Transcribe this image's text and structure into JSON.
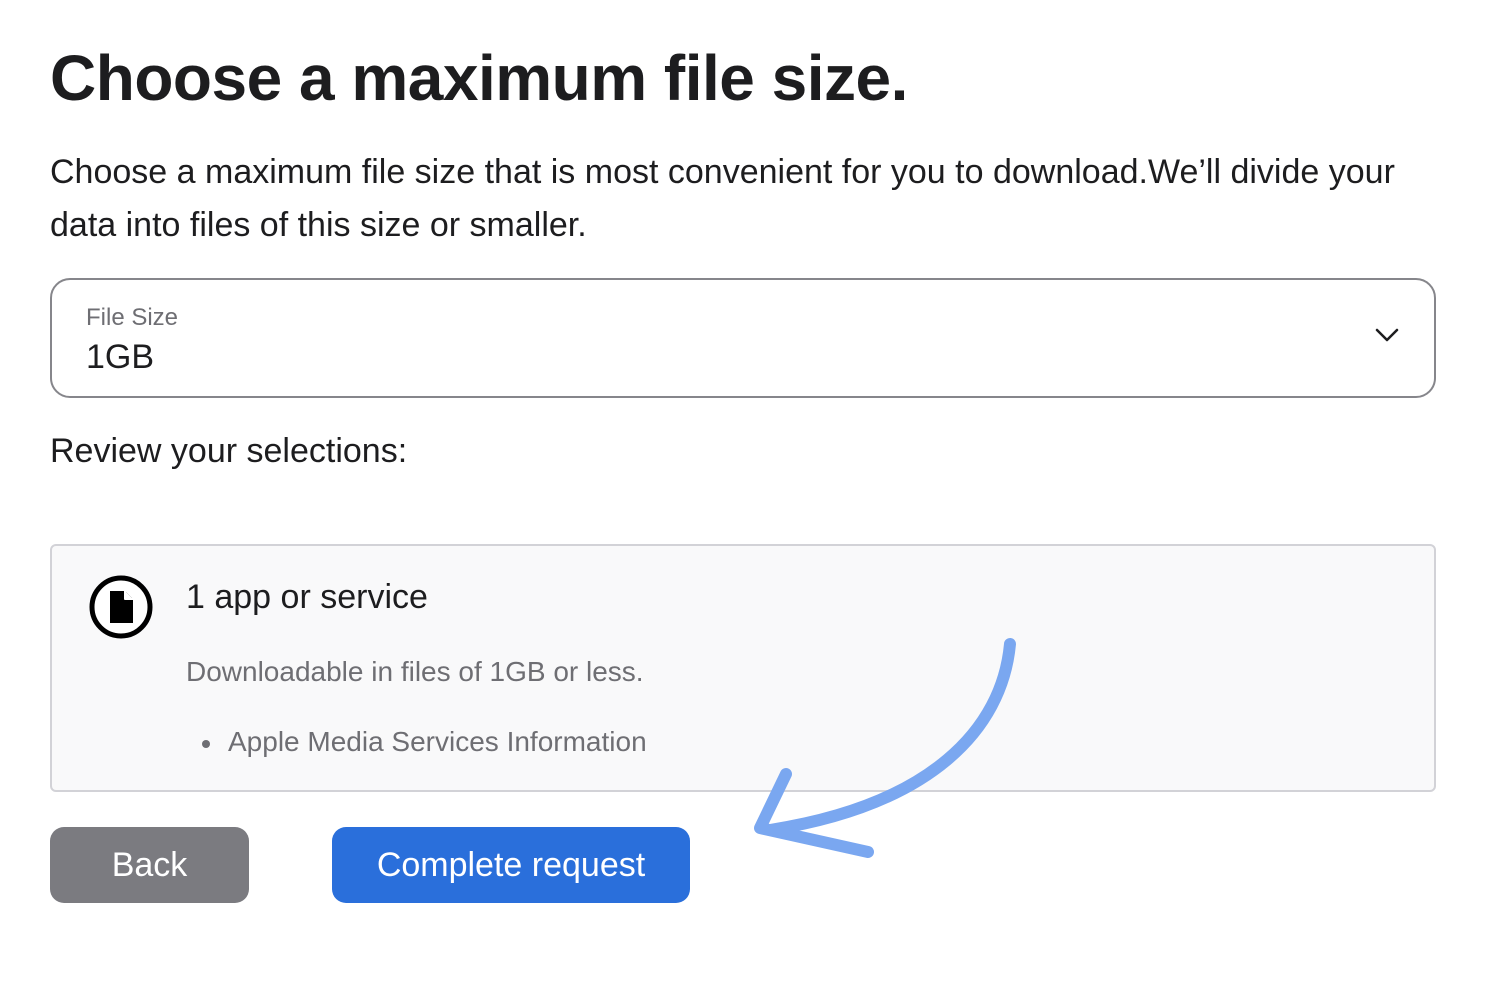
{
  "page": {
    "title": "Choose a maximum file size.",
    "description": "Choose a maximum file size that is most convenient for you to download.We’ll divide your data into files of this size or smaller."
  },
  "file_size_select": {
    "label": "File Size",
    "selected_value": "1GB",
    "icon": "chevron-down-icon"
  },
  "review": {
    "heading": "Review your selections:",
    "summary": {
      "icon": "document-icon",
      "title": "1 app or service",
      "subtitle": "Downloadable in files of 1GB or less.",
      "items": [
        "Apple Media Services Information"
      ]
    }
  },
  "actions": {
    "back_label": "Back",
    "complete_label": "Complete request"
  },
  "annotation": {
    "icon": "hand-drawn-arrow",
    "color": "#7aa7f0"
  },
  "colors": {
    "primary_button": "#2a6fdb",
    "secondary_button": "#7b7b80",
    "text": "#1d1d1f",
    "muted_text": "#6e6e73"
  }
}
